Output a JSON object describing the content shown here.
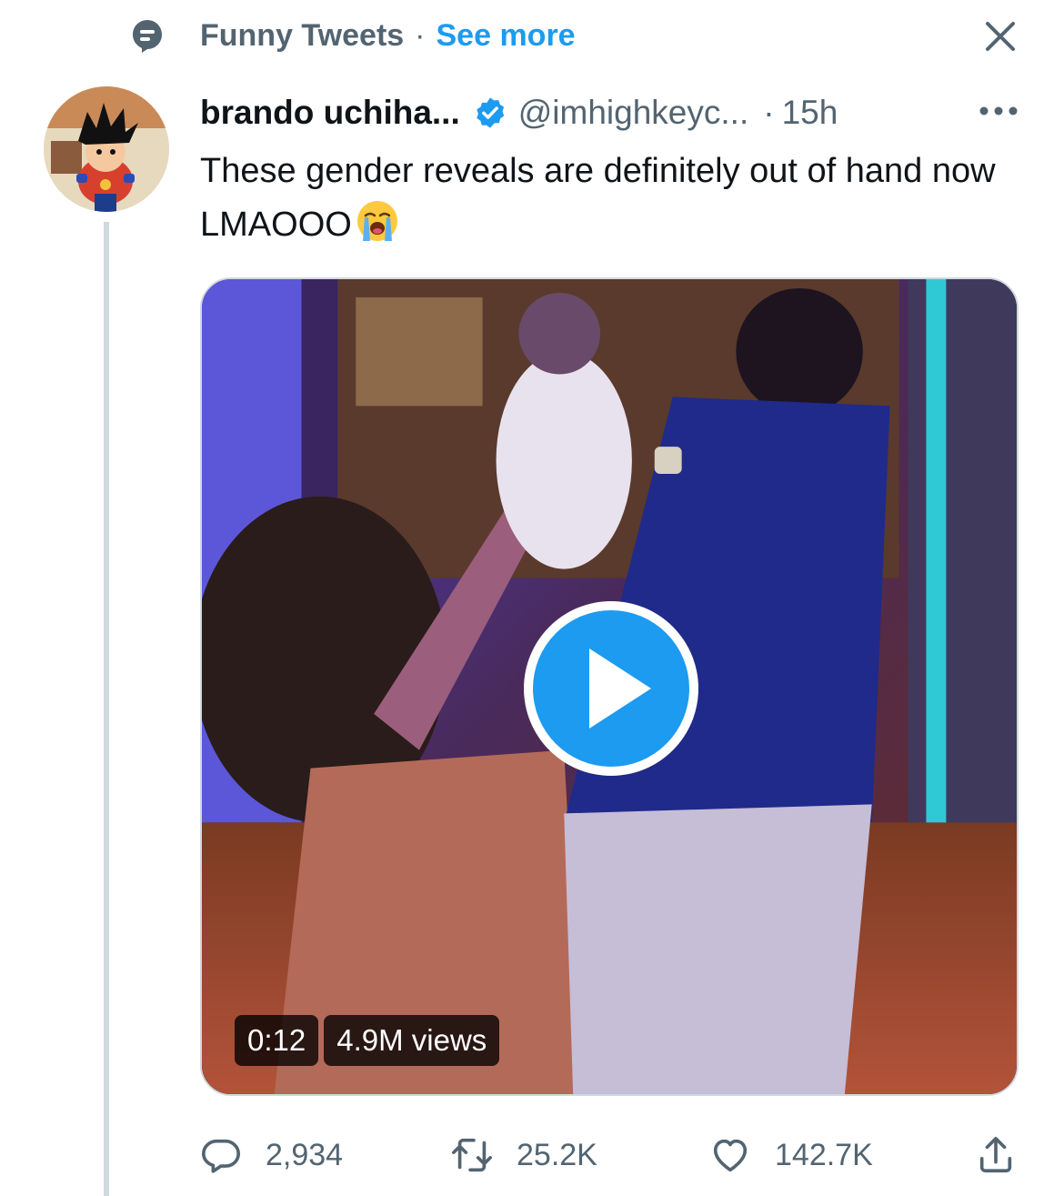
{
  "context_bar": {
    "label": "Funny Tweets",
    "separator": "·",
    "see_more": "See more",
    "icon": "topic-icon",
    "close_icon": "close-icon"
  },
  "tweet": {
    "author_name": "brando uchiha...",
    "handle": "@imhighkeyc...",
    "separator": "·",
    "time": "15h",
    "verified": true,
    "text": "These gender reveals are definitely out of hand now LMAOOO",
    "emoji": "loudly-crying-face",
    "media": {
      "type": "video",
      "duration": "0:12",
      "views": "4.9M views"
    },
    "actions": {
      "replies": "2,934",
      "retweets": "25.2K",
      "likes": "142.7K"
    }
  },
  "colors": {
    "accent": "#1d9bf0",
    "secondary_text": "#536471",
    "primary_text": "#0f1419"
  }
}
